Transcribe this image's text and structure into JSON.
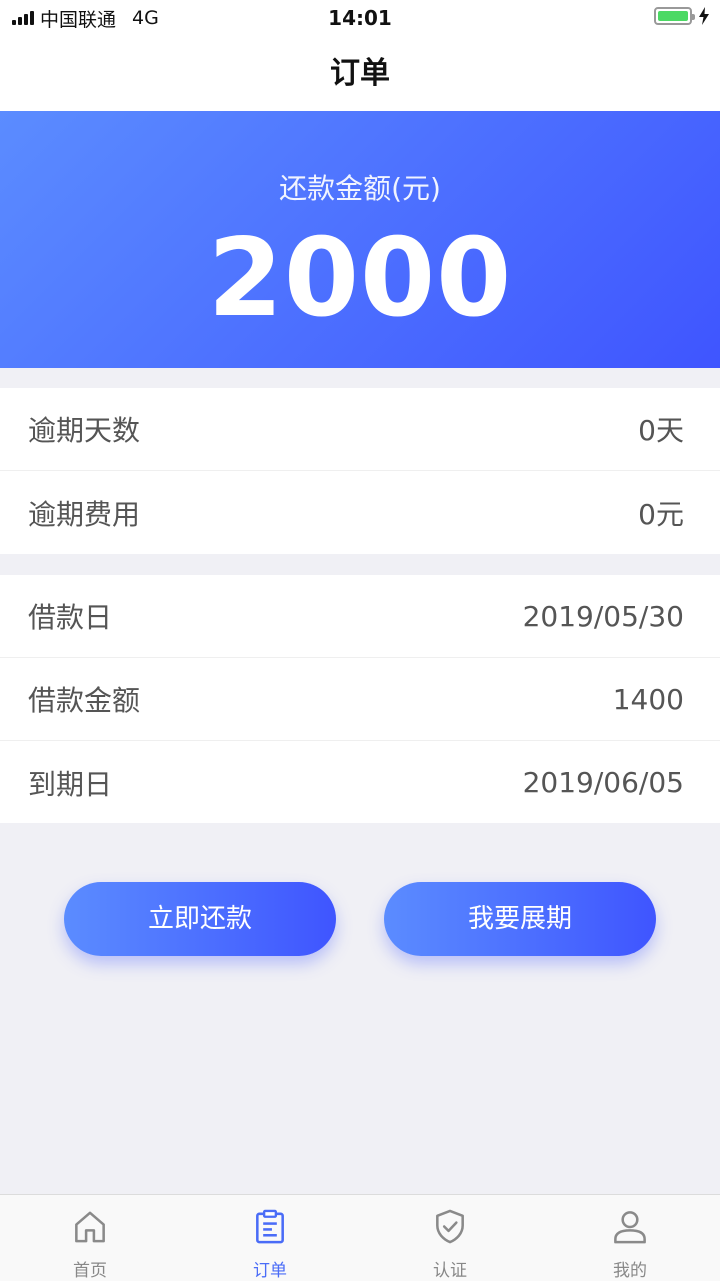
{
  "status_bar": {
    "carrier": "中国联通",
    "network": "4G",
    "time": "14:01"
  },
  "nav": {
    "title": "订单"
  },
  "banner": {
    "label": "还款金额(元)",
    "amount": "2000"
  },
  "overdue": {
    "rows": [
      {
        "label": "逾期天数",
        "value": "0天"
      },
      {
        "label": "逾期费用",
        "value": "0元"
      }
    ]
  },
  "loan": {
    "rows": [
      {
        "label": "借款日",
        "value": "2019/05/30"
      },
      {
        "label": "借款金额",
        "value": "1400"
      },
      {
        "label": "到期日",
        "value": "2019/06/05"
      }
    ]
  },
  "actions": {
    "repay_label": "立即还款",
    "extend_label": "我要展期"
  },
  "tabs": [
    {
      "label": "首页",
      "icon": "home-icon"
    },
    {
      "label": "订单",
      "icon": "order-icon",
      "active": true
    },
    {
      "label": "认证",
      "icon": "shield-check-icon"
    },
    {
      "label": "我的",
      "icon": "user-icon"
    }
  ],
  "colors": {
    "accent": "#4a6cf7",
    "gradient_start": "#5b8cff",
    "gradient_end": "#3f55ff",
    "battery": "#4cd964"
  }
}
